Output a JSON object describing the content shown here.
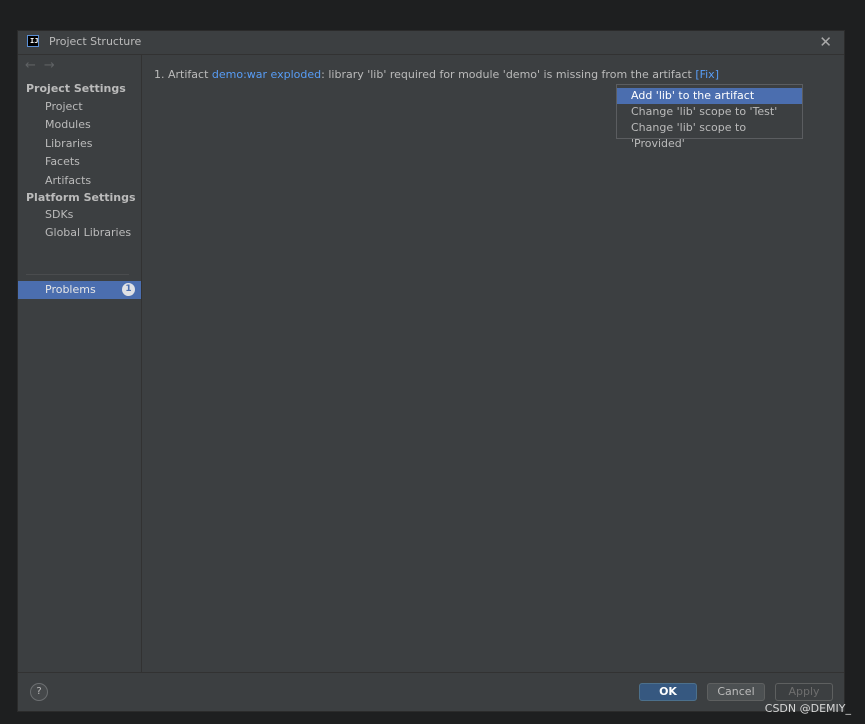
{
  "window": {
    "title": "Project Structure",
    "app_icon_text": "IJ",
    "close_glyph": "✕"
  },
  "sidebar": {
    "back_glyph": "←",
    "forward_glyph": "→",
    "project_settings_heading": "Project Settings",
    "project_items": [
      {
        "label": "Project"
      },
      {
        "label": "Modules"
      },
      {
        "label": "Libraries"
      },
      {
        "label": "Facets"
      },
      {
        "label": "Artifacts"
      }
    ],
    "platform_settings_heading": "Platform Settings",
    "platform_items": [
      {
        "label": "SDKs"
      },
      {
        "label": "Global Libraries"
      }
    ],
    "problems": {
      "label": "Problems",
      "count": "1"
    }
  },
  "main": {
    "problem": {
      "prefix": "1. Artifact ",
      "artifact_link": "demo:war exploded",
      "message": ": library 'lib' required for module 'demo' is missing from the artifact ",
      "fix_link": "[Fix]"
    },
    "fix_popup": {
      "items": [
        {
          "label": "Add 'lib' to the artifact"
        },
        {
          "label": "Change 'lib' scope to 'Test'"
        },
        {
          "label": "Change 'lib' scope to 'Provided'"
        }
      ],
      "selected_index": 0
    }
  },
  "footer": {
    "help_glyph": "?",
    "ok_label": "OK",
    "cancel_label": "Cancel",
    "apply_label": "Apply"
  },
  "watermark": "CSDN @DEMIY_",
  "colors": {
    "accent": "#4b6eaf",
    "link": "#589df6",
    "background": "#3c3f41"
  }
}
